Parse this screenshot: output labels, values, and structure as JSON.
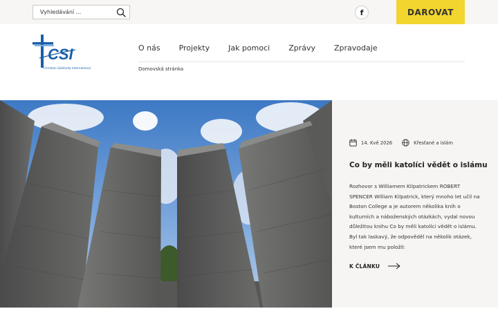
{
  "topbar": {
    "search_placeholder": "Vyhledávání ...",
    "facebook_label": "f",
    "donate_label": "DAROVAT"
  },
  "logo": {
    "letters": "CSI",
    "subtitle": "Christian Solidarity International"
  },
  "nav": {
    "items": [
      {
        "label": "O nás"
      },
      {
        "label": "Projekty"
      },
      {
        "label": "Jak pomoci"
      },
      {
        "label": "Zprávy"
      },
      {
        "label": "Zpravodaje"
      }
    ]
  },
  "breadcrumb": {
    "home_label": "Domovská stránka"
  },
  "article": {
    "date": "14. Kvě 2026",
    "category": "Křesťané a islám",
    "title": "Co by měli katolíci vědět o islámu",
    "excerpt_lines": [
      "Rozhovor s Williamem Kilpatrickem ROBERT",
      "SPENCER William Kilpatrick, který mnoho let učil na",
      "Boston College a je autorem několika knih o",
      "kulturních a náboženských otázkách, vydal novou",
      "důležitou knihu Co by měli katolíci vědět o islámu.",
      "Byl tak laskavý, že odpověděl na několik otázek,",
      "které jsem mu položil:"
    ],
    "read_more_label": "K ČLÁNKU"
  },
  "colors": {
    "accent_yellow": "#f2d52e",
    "brand_blue": "#1a5fa8",
    "topbar_bg": "#f7f6f4",
    "panel_bg": "#f6f5f3"
  }
}
